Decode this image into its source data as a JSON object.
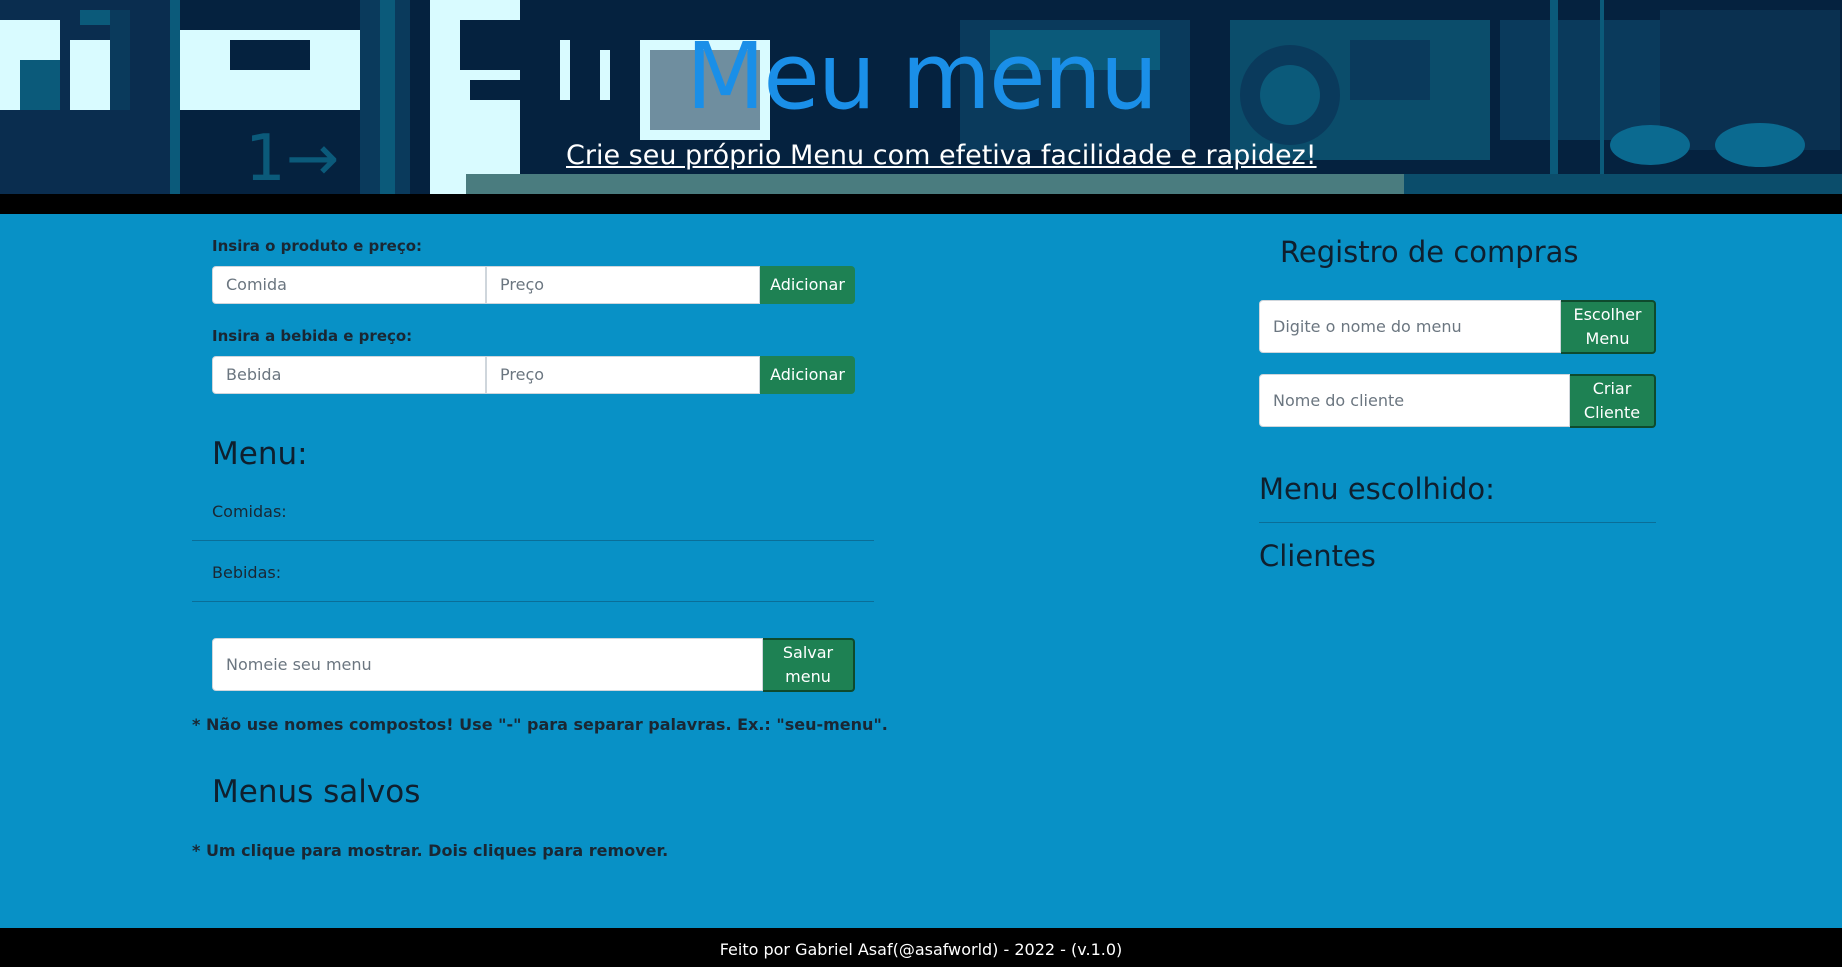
{
  "header": {
    "title": "Meu menu",
    "tagline": "Crie seu próprio Menu com efetiva facilidade e rapidez!"
  },
  "food_form": {
    "label": "Insira o produto e preço:",
    "name_placeholder": "Comida",
    "price_placeholder": "Preço",
    "add_label": "Adicionar"
  },
  "drink_form": {
    "label": "Insira a bebida e preço:",
    "name_placeholder": "Bebida",
    "price_placeholder": "Preço",
    "add_label": "Adicionar"
  },
  "menu": {
    "heading": "Menu:",
    "foods_label": "Comidas:",
    "drinks_label": "Bebidas:"
  },
  "save_menu": {
    "placeholder": "Nomeie seu menu",
    "button_line1": "Salvar",
    "button_line2": "menu",
    "note": "* Não use nomes compostos! Use \"-\" para separar palavras. Ex.: \"seu-menu\"."
  },
  "saved_menus": {
    "heading": "Menus salvos",
    "note": "* Um clique para mostrar. Dois cliques para remover."
  },
  "register": {
    "heading": "Registro de compras",
    "menu_placeholder": "Digite o nome do menu",
    "choose_line1": "Escolher",
    "choose_line2": "Menu",
    "client_placeholder": "Nome do cliente",
    "create_line1": "Criar",
    "create_line2": "Cliente",
    "chosen_heading": "Menu escolhido:",
    "clients_heading": "Clientes"
  },
  "footer": {
    "text": "Feito por Gabriel Asaf(@asafworld) - 2022 - (v.1.0)"
  },
  "colors": {
    "background": "#0891c6",
    "header_bg": "#05223f",
    "title": "#1a8fe8",
    "button": "#1e8153"
  }
}
